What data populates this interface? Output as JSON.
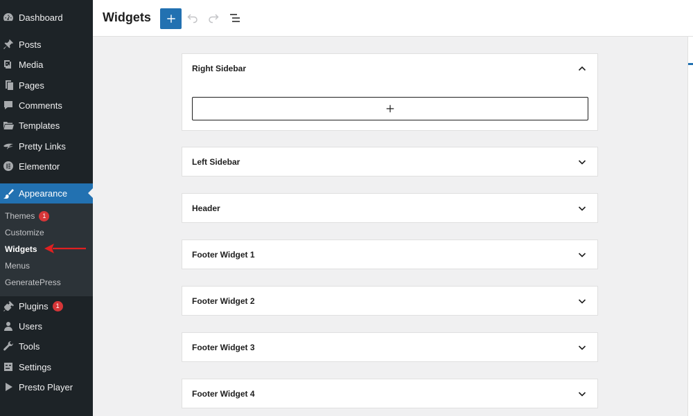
{
  "sidebar": {
    "items": [
      {
        "label": "Dashboard",
        "icon": "dashboard-icon"
      },
      {
        "label": "Posts",
        "icon": "pin-icon"
      },
      {
        "label": "Media",
        "icon": "media-icon"
      },
      {
        "label": "Pages",
        "icon": "pages-icon"
      },
      {
        "label": "Comments",
        "icon": "comments-icon"
      },
      {
        "label": "Templates",
        "icon": "folder-icon"
      },
      {
        "label": "Pretty Links",
        "icon": "pretty-links-icon"
      },
      {
        "label": "Elementor",
        "icon": "elementor-icon"
      },
      {
        "label": "Appearance",
        "icon": "paintbrush-icon"
      },
      {
        "label": "Plugins",
        "icon": "plugin-icon",
        "badge": "1"
      },
      {
        "label": "Users",
        "icon": "users-icon"
      },
      {
        "label": "Tools",
        "icon": "wrench-icon"
      },
      {
        "label": "Settings",
        "icon": "settings-icon"
      },
      {
        "label": "Presto Player",
        "icon": "play-icon"
      }
    ],
    "submenu": [
      {
        "label": "Themes",
        "badge": "1"
      },
      {
        "label": "Customize"
      },
      {
        "label": "Widgets"
      },
      {
        "label": "Menus"
      },
      {
        "label": "GeneratePress"
      }
    ]
  },
  "header": {
    "title": "Widgets",
    "add_icon": "plus-icon",
    "undo_icon": "undo-icon",
    "redo_icon": "redo-icon",
    "list_view_icon": "list-view-icon"
  },
  "widget_areas": [
    {
      "title": "Right Sidebar",
      "expanded": true
    },
    {
      "title": "Left Sidebar",
      "expanded": false
    },
    {
      "title": "Header",
      "expanded": false
    },
    {
      "title": "Footer Widget 1",
      "expanded": false
    },
    {
      "title": "Footer Widget 2",
      "expanded": false
    },
    {
      "title": "Footer Widget 3",
      "expanded": false
    },
    {
      "title": "Footer Widget 4",
      "expanded": false
    }
  ],
  "colors": {
    "accent": "#2271b1",
    "sidebar_bg": "#1d2327",
    "submenu_bg": "#2c3338",
    "badge": "#d63638",
    "annotation_arrow": "#e02020"
  }
}
